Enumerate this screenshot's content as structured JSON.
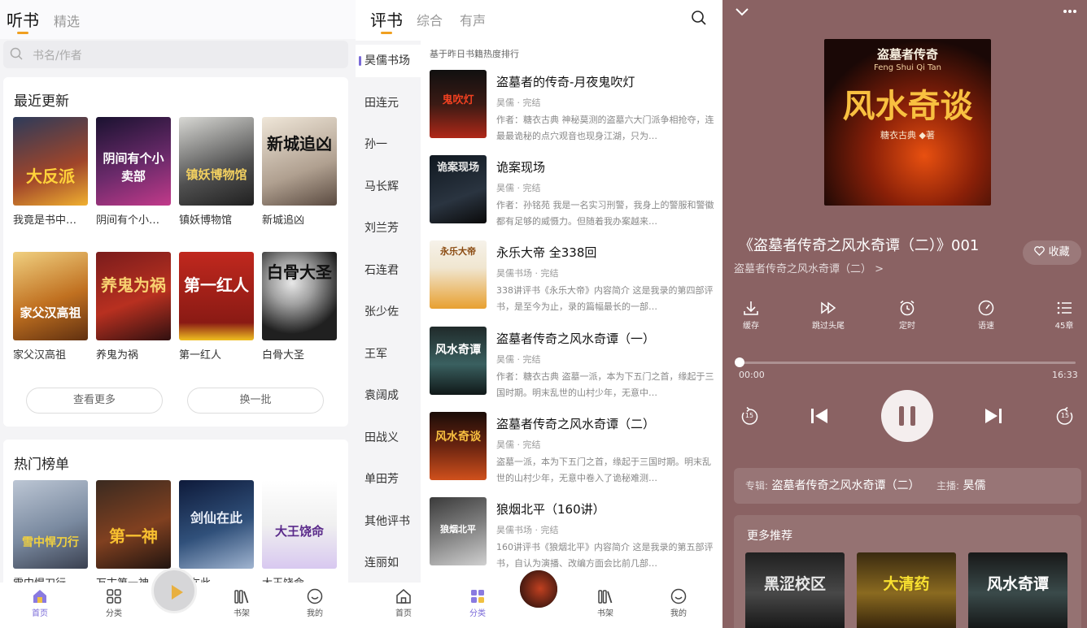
{
  "panel1": {
    "tabs": [
      "听书",
      "精选"
    ],
    "search_placeholder": "书名/作者",
    "recent": {
      "title": "最近更新",
      "books": [
        {
          "title": "我竟是书中…",
          "cover_text": "大反派"
        },
        {
          "title": "阴间有个小…",
          "cover_text": "阴间有个小卖部"
        },
        {
          "title": "镇妖博物馆",
          "cover_text": "镇妖博物馆"
        },
        {
          "title": "新城追凶",
          "cover_text": "新城追凶"
        },
        {
          "title": "家父汉高祖",
          "cover_text": "家父汉高祖"
        },
        {
          "title": "养鬼为祸",
          "cover_text": "养鬼为祸"
        },
        {
          "title": "第一红人",
          "cover_text": "第一红人"
        },
        {
          "title": "白骨大圣",
          "cover_text": "白骨大圣"
        }
      ],
      "more_label": "查看更多",
      "refresh_label": "换一批"
    },
    "hot": {
      "title": "热门榜单",
      "books": [
        {
          "title": "雪中悍刀行",
          "cover_text": "雪中悍刀行"
        },
        {
          "title": "万古第一神",
          "cover_text": "第一神"
        },
        {
          "title": "仙在此",
          "cover_text": "剑仙在此"
        },
        {
          "title": "大王饶命",
          "cover_text": "大王饶命"
        }
      ]
    },
    "tabbar": [
      {
        "label": "首页"
      },
      {
        "label": "分类"
      },
      {
        "label": "书架"
      },
      {
        "label": "我的"
      }
    ]
  },
  "panel2": {
    "tabs": [
      "评书",
      "综合",
      "有声"
    ],
    "sidebar": [
      "昊儒书场",
      "田连元",
      "孙一",
      "马长辉",
      "刘兰芳",
      "石连君",
      "张少佐",
      "王军",
      "袁阔成",
      "田战义",
      "单田芳",
      "其他评书",
      "连丽如"
    ],
    "rank_note": "基于昨日书籍热度排行",
    "items": [
      {
        "title": "盗墓者的传奇-月夜鬼吹灯",
        "meta": "昊儒 · 完结",
        "desc": "作者：糖衣古典 神秘莫测的盗墓六大门派争相抢夺，连最最诡秘的点穴观音也现身江湖，只为…",
        "cover_text": "鬼吹灯"
      },
      {
        "title": "诡案现场",
        "meta": "昊儒 · 完结",
        "desc": "作者：孙铭苑 我是一名实习刑警，我身上的警服和警徽都有足够的威慑力。但随着我办案越来…",
        "cover_text": "诡案现场"
      },
      {
        "title": "永乐大帝 全338回",
        "meta": "昊儒书场 · 完结",
        "desc": "338讲评书《永乐大帝》内容简介 这是我录的第四部评书，是至今为止，录的篇幅最长的一部…",
        "cover_text": "永乐大帝"
      },
      {
        "title": "盗墓者传奇之风水奇谭（一）",
        "meta": "昊儒 · 完结",
        "desc": "作者：糖衣古典 盗墓一派，本为下五门之首，缘起于三国时期。明末乱世的山村少年，无意中…",
        "cover_text": "风水奇谭"
      },
      {
        "title": "盗墓者传奇之风水奇谭（二）",
        "meta": "昊儒 · 完结",
        "desc": "盗墓一派，本为下五门之首，缘起于三国时期。明末乱世的山村少年，无意中卷入了诡秘难测…",
        "cover_text": "风水奇谈"
      },
      {
        "title": "狼烟北平（160讲）",
        "meta": "昊儒书场 · 完结",
        "desc": "160讲评书《狼烟北平》内容简介 这是我录的第五部评书，自认为演播、改编方面会比前几部…",
        "cover_text": "狼烟北平"
      }
    ],
    "tabbar": [
      {
        "label": "首页"
      },
      {
        "label": "分类"
      },
      {
        "label": "书架"
      },
      {
        "label": "我的"
      }
    ]
  },
  "panel3": {
    "cover_title": "风水奇谈",
    "cover_top": "盗墓者传奇",
    "cover_pinyin": "Feng  Shui  Qi  Tan",
    "cover_author": "糖衣古典 ◆著",
    "episode_title": "《盗墓者传奇之风水奇谭（二）》001",
    "album_link": "盗墓者传奇之风水奇谭（二） >",
    "fav_label": "收藏",
    "controls": [
      {
        "label": "缓存"
      },
      {
        "label": "跳过头尾"
      },
      {
        "label": "定时"
      },
      {
        "label": "语速"
      },
      {
        "label": "45章"
      }
    ],
    "time_start": "00:00",
    "time_end": "16:33",
    "progress": 0.0,
    "rewind_label": "15",
    "forward_label": "15",
    "album_key": "专辑:",
    "album_value": "盗墓者传奇之风水奇谭（二）",
    "host_key": "主播:",
    "host_value": "昊儒",
    "recommend_title": "更多推荐",
    "recommend": [
      {
        "cover_text": "黑涩校区"
      },
      {
        "cover_text": "大清药"
      },
      {
        "cover_text": "风水奇谭"
      }
    ]
  },
  "colors": {
    "accent": "#7a6ad8",
    "tab_underline": "#f0a020",
    "player_bg": "#8a6263"
  }
}
